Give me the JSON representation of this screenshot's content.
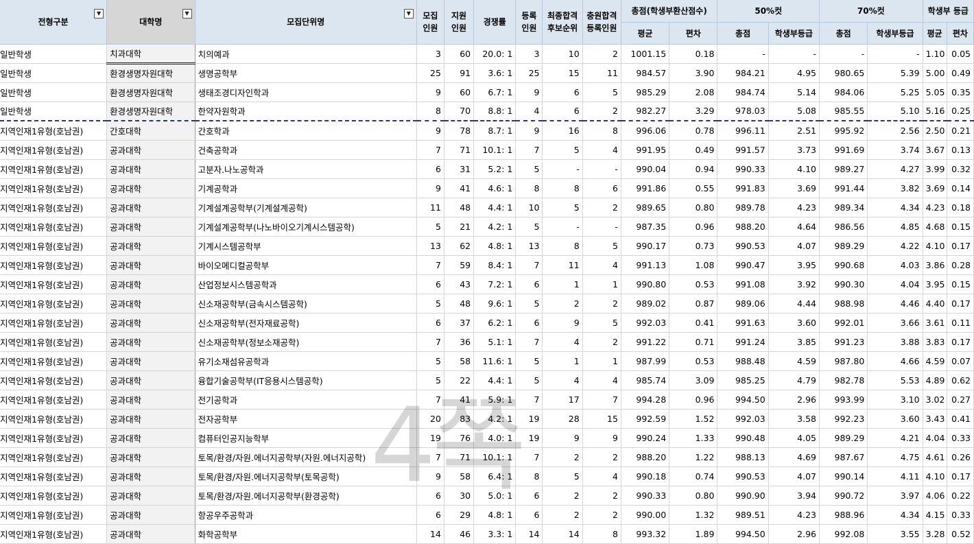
{
  "header": {
    "col_type": "전형구분",
    "col_college": "대학명",
    "col_unit": "모집단위명",
    "col_quota": "모집\n인원",
    "col_applicants": "지원\n인원",
    "col_ratio": "경쟁률",
    "col_registered": "등록\n인원",
    "col_waitlist": "최종합격\n후보순위",
    "col_refill": "충원합격\n등록인원",
    "grp_total": "총점(학생부환산점수)",
    "grp_50": "50%컷",
    "grp_70": "70%컷",
    "grp_grade": "학생부 등급",
    "sub_avg": "평균",
    "sub_dev": "편차",
    "sub_total": "총점",
    "sub_grade": "학생부등급",
    "sub_total2": "총점",
    "sub_grade2": "학생부등급",
    "sub_avg2": "평균",
    "sub_dev2": "편차"
  },
  "rows": [
    [
      "일반학생",
      "치과대학",
      "치의예과",
      "3",
      "60",
      "20.0: 1",
      "3",
      "10",
      "2",
      "1001.15",
      "0.18",
      "-",
      "-",
      "-",
      "-",
      "1.10",
      "0.05"
    ],
    [
      "일반학생",
      "환경생명자원대학",
      "생명공학부",
      "25",
      "91",
      "3.6: 1",
      "25",
      "15",
      "11",
      "984.57",
      "3.90",
      "984.21",
      "4.95",
      "980.65",
      "5.39",
      "5.00",
      "0.49"
    ],
    [
      "일반학생",
      "환경생명자원대학",
      "생태조경디자인학과",
      "9",
      "60",
      "6.7: 1",
      "9",
      "6",
      "5",
      "985.29",
      "2.08",
      "984.74",
      "5.14",
      "984.06",
      "5.25",
      "5.05",
      "0.35"
    ],
    [
      "일반학생",
      "환경생명자원대학",
      "한약자원학과",
      "8",
      "70",
      "8.8: 1",
      "4",
      "6",
      "2",
      "982.27",
      "3.29",
      "978.03",
      "5.08",
      "985.55",
      "5.10",
      "5.16",
      "0.25"
    ],
    [
      "지역인재1유형(호남권)",
      "간호대학",
      "간호학과",
      "9",
      "78",
      "8.7: 1",
      "9",
      "16",
      "8",
      "996.06",
      "0.78",
      "996.11",
      "2.51",
      "995.92",
      "2.56",
      "2.50",
      "0.21"
    ],
    [
      "지역인재1유형(호남권)",
      "공과대학",
      "건축공학과",
      "7",
      "71",
      "10.1: 1",
      "7",
      "5",
      "4",
      "991.95",
      "0.49",
      "991.57",
      "3.73",
      "991.69",
      "3.74",
      "3.67",
      "0.13"
    ],
    [
      "지역인재1유형(호남권)",
      "공과대학",
      "고분자.나노공학과",
      "6",
      "31",
      "5.2: 1",
      "5",
      "-",
      "-",
      "990.04",
      "0.94",
      "990.33",
      "4.10",
      "989.27",
      "4.27",
      "3.99",
      "0.32"
    ],
    [
      "지역인재1유형(호남권)",
      "공과대학",
      "기계공학과",
      "9",
      "41",
      "4.6: 1",
      "8",
      "8",
      "6",
      "991.86",
      "0.55",
      "991.83",
      "3.69",
      "991.44",
      "3.82",
      "3.69",
      "0.14"
    ],
    [
      "지역인재1유형(호남권)",
      "공과대학",
      "기계설계공학부(기계설계공학)",
      "11",
      "48",
      "4.4: 1",
      "10",
      "5",
      "2",
      "989.65",
      "0.80",
      "989.78",
      "4.23",
      "989.34",
      "4.34",
      "4.23",
      "0.18"
    ],
    [
      "지역인재1유형(호남권)",
      "공과대학",
      "기계설계공학부(나노바이오기계시스템공학)",
      "5",
      "21",
      "4.2: 1",
      "5",
      "-",
      "-",
      "987.35",
      "0.96",
      "988.20",
      "4.64",
      "986.56",
      "4.85",
      "4.68",
      "0.15"
    ],
    [
      "지역인재1유형(호남권)",
      "공과대학",
      "기계시스템공학부",
      "13",
      "62",
      "4.8: 1",
      "13",
      "8",
      "5",
      "990.17",
      "0.73",
      "990.53",
      "4.07",
      "989.29",
      "4.22",
      "4.10",
      "0.17"
    ],
    [
      "지역인재1유형(호남권)",
      "공과대학",
      "바이오메디컬공학부",
      "7",
      "59",
      "8.4: 1",
      "7",
      "11",
      "4",
      "991.13",
      "1.08",
      "990.47",
      "3.95",
      "990.68",
      "4.03",
      "3.86",
      "0.28"
    ],
    [
      "지역인재1유형(호남권)",
      "공과대학",
      "산업정보시스템공학과",
      "6",
      "43",
      "7.2: 1",
      "6",
      "1",
      "1",
      "990.80",
      "0.53",
      "991.08",
      "3.92",
      "990.30",
      "4.04",
      "3.95",
      "0.15"
    ],
    [
      "지역인재1유형(호남권)",
      "공과대학",
      "신소재공학부(금속시스템공학)",
      "5",
      "48",
      "9.6: 1",
      "5",
      "2",
      "2",
      "989.02",
      "0.87",
      "989.06",
      "4.44",
      "988.98",
      "4.46",
      "4.40",
      "0.17"
    ],
    [
      "지역인재1유형(호남권)",
      "공과대학",
      "신소재공학부(전자재료공학)",
      "6",
      "37",
      "6.2: 1",
      "6",
      "9",
      "5",
      "992.03",
      "0.41",
      "991.63",
      "3.60",
      "992.01",
      "3.66",
      "3.61",
      "0.11"
    ],
    [
      "지역인재1유형(호남권)",
      "공과대학",
      "신소재공학부(정보소재공학)",
      "7",
      "36",
      "5.1: 1",
      "7",
      "4",
      "2",
      "991.22",
      "0.71",
      "991.24",
      "3.85",
      "991.23",
      "3.88",
      "3.83",
      "0.17"
    ],
    [
      "지역인재1유형(호남권)",
      "공과대학",
      "유기소재섬유공학과",
      "5",
      "58",
      "11.6: 1",
      "5",
      "1",
      "1",
      "987.99",
      "0.53",
      "988.48",
      "4.59",
      "987.80",
      "4.66",
      "4.59",
      "0.07"
    ],
    [
      "지역인재1유형(호남권)",
      "공과대학",
      "융합기술공학부(IT응용시스템공학)",
      "5",
      "22",
      "4.4: 1",
      "5",
      "4",
      "4",
      "985.74",
      "3.09",
      "985.25",
      "4.79",
      "982.78",
      "5.53",
      "4.89",
      "0.62"
    ],
    [
      "지역인재1유형(호남권)",
      "공과대학",
      "전기공학과",
      "7",
      "41",
      "5.9: 1",
      "7",
      "17",
      "7",
      "994.28",
      "0.96",
      "994.50",
      "2.96",
      "993.99",
      "3.10",
      "3.02",
      "0.27"
    ],
    [
      "지역인재1유형(호남권)",
      "공과대학",
      "전자공학부",
      "20",
      "83",
      "4.2: 1",
      "19",
      "28",
      "15",
      "992.59",
      "1.52",
      "992.03",
      "3.58",
      "992.23",
      "3.60",
      "3.43",
      "0.41"
    ],
    [
      "지역인재1유형(호남권)",
      "공과대학",
      "컴퓨터인공지능학부",
      "19",
      "76",
      "4.0: 1",
      "19",
      "9",
      "9",
      "990.24",
      "1.33",
      "990.48",
      "4.05",
      "989.29",
      "4.21",
      "4.04",
      "0.33"
    ],
    [
      "지역인재1유형(호남권)",
      "공과대학",
      "토목/환경/자원.에너지공학부(자원.에너지공학)",
      "7",
      "71",
      "10.1: 1",
      "7",
      "2",
      "2",
      "988.20",
      "1.22",
      "988.13",
      "4.69",
      "987.67",
      "4.75",
      "4.61",
      "0.26"
    ],
    [
      "지역인재1유형(호남권)",
      "공과대학",
      "토목/환경/자원.에너지공학부(토목공학)",
      "9",
      "58",
      "6.4: 1",
      "8",
      "5",
      "4",
      "990.18",
      "0.74",
      "990.53",
      "4.07",
      "990.14",
      "4.11",
      "4.10",
      "0.17"
    ],
    [
      "지역인재1유형(호남권)",
      "공과대학",
      "토목/환경/자원.에너지공학부(환경공학)",
      "6",
      "30",
      "5.0: 1",
      "6",
      "2",
      "2",
      "990.33",
      "0.80",
      "990.90",
      "3.94",
      "990.72",
      "3.97",
      "4.06",
      "0.22"
    ],
    [
      "지역인재1유형(호남권)",
      "공과대학",
      "항공우주공학과",
      "6",
      "29",
      "4.8: 1",
      "6",
      "2",
      "2",
      "990.00",
      "1.32",
      "989.51",
      "4.23",
      "988.96",
      "4.34",
      "4.15",
      "0.33"
    ],
    [
      "지역인재1유형(호남권)",
      "공과대학",
      "화학공학부",
      "14",
      "46",
      "3.3: 1",
      "14",
      "14",
      "8",
      "993.32",
      "1.89",
      "994.50",
      "2.96",
      "992.08",
      "3.55",
      "3.28",
      "0.52"
    ]
  ],
  "watermark": "4쪽",
  "filter_icon": "dropdown-arrow-icon"
}
